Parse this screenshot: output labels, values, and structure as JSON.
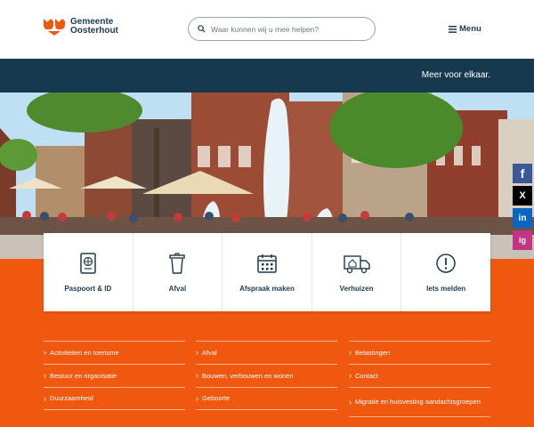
{
  "header": {
    "logo_line1": "Gemeente",
    "logo_line2": "Oosterhout",
    "search_placeholder": "Waar kunnen wij u mee helpen?",
    "menu_label": "Menu",
    "menu_icon": "hamburger-icon"
  },
  "banner": {
    "tagline": "Meer voor elkaar."
  },
  "hero": {
    "description_icon": "town-square-fountain-photo"
  },
  "cards": [
    {
      "label": "Paspoort & ID",
      "icon": "passport-icon"
    },
    {
      "label": "Afval",
      "icon": "waste-bin-icon"
    },
    {
      "label": "Afspraak maken",
      "icon": "calendar-icon"
    },
    {
      "label": "Verhuizen",
      "icon": "moving-truck-icon"
    },
    {
      "label": "Iets melden",
      "icon": "exclamation-icon"
    }
  ],
  "links": {
    "col1": [
      "Activiteiten en toerisme",
      "Bestuur en organisatie",
      "Duurzaamheid"
    ],
    "col2": [
      "Afval",
      "Bouwen, verbouwen en wonen",
      "Geboorte"
    ],
    "col3": [
      "Belastingen",
      "Contact",
      "Migratie en huisvesting aandachtsgroepen"
    ]
  },
  "social": [
    {
      "label": "f",
      "icon": "facebook-icon",
      "color": "#3b5998"
    },
    {
      "label": "X",
      "icon": "x-icon",
      "color": "#000000"
    },
    {
      "label": "in",
      "icon": "linkedin-icon",
      "color": "#0a66c2"
    },
    {
      "label": "ig",
      "icon": "instagram-icon",
      "color": "#c13584"
    }
  ],
  "colors": {
    "navy": "#17394f",
    "orange": "#f0570f",
    "text": "#1d3a4f"
  }
}
